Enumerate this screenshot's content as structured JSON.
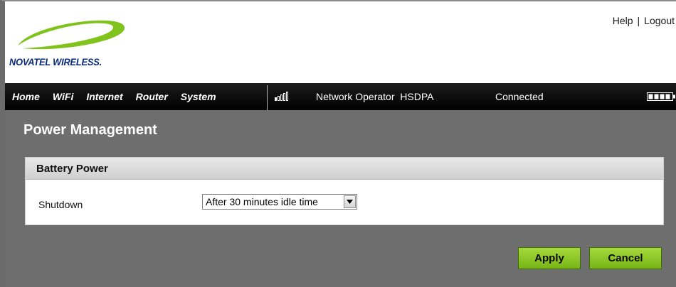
{
  "brand": {
    "logo_text": "NOVATEL WIRELESS."
  },
  "top_links": {
    "help": "Help",
    "separator": "|",
    "logout": "Logout"
  },
  "nav": {
    "items": [
      {
        "label": "Home"
      },
      {
        "label": "WiFi"
      },
      {
        "label": "Internet"
      },
      {
        "label": "Router"
      },
      {
        "label": "System"
      }
    ]
  },
  "status": {
    "signal_bars_on": 1,
    "signal_bars_total": 5,
    "operator": "Network Operator",
    "network_type": "HSDPA",
    "connection": "Connected",
    "battery_icon": "battery-icon"
  },
  "page": {
    "title": "Power Management"
  },
  "panel": {
    "heading": "Battery Power",
    "shutdown_label": "Shutdown",
    "shutdown_value": "After 30 minutes idle time"
  },
  "actions": {
    "apply": "Apply",
    "cancel": "Cancel"
  },
  "colors": {
    "logo_green": "#7fc31c",
    "logo_navy": "#0a2a7a",
    "nav_bg": "#000000",
    "content_bg": "#6e6e6e",
    "button_green": "#8fc62c"
  }
}
